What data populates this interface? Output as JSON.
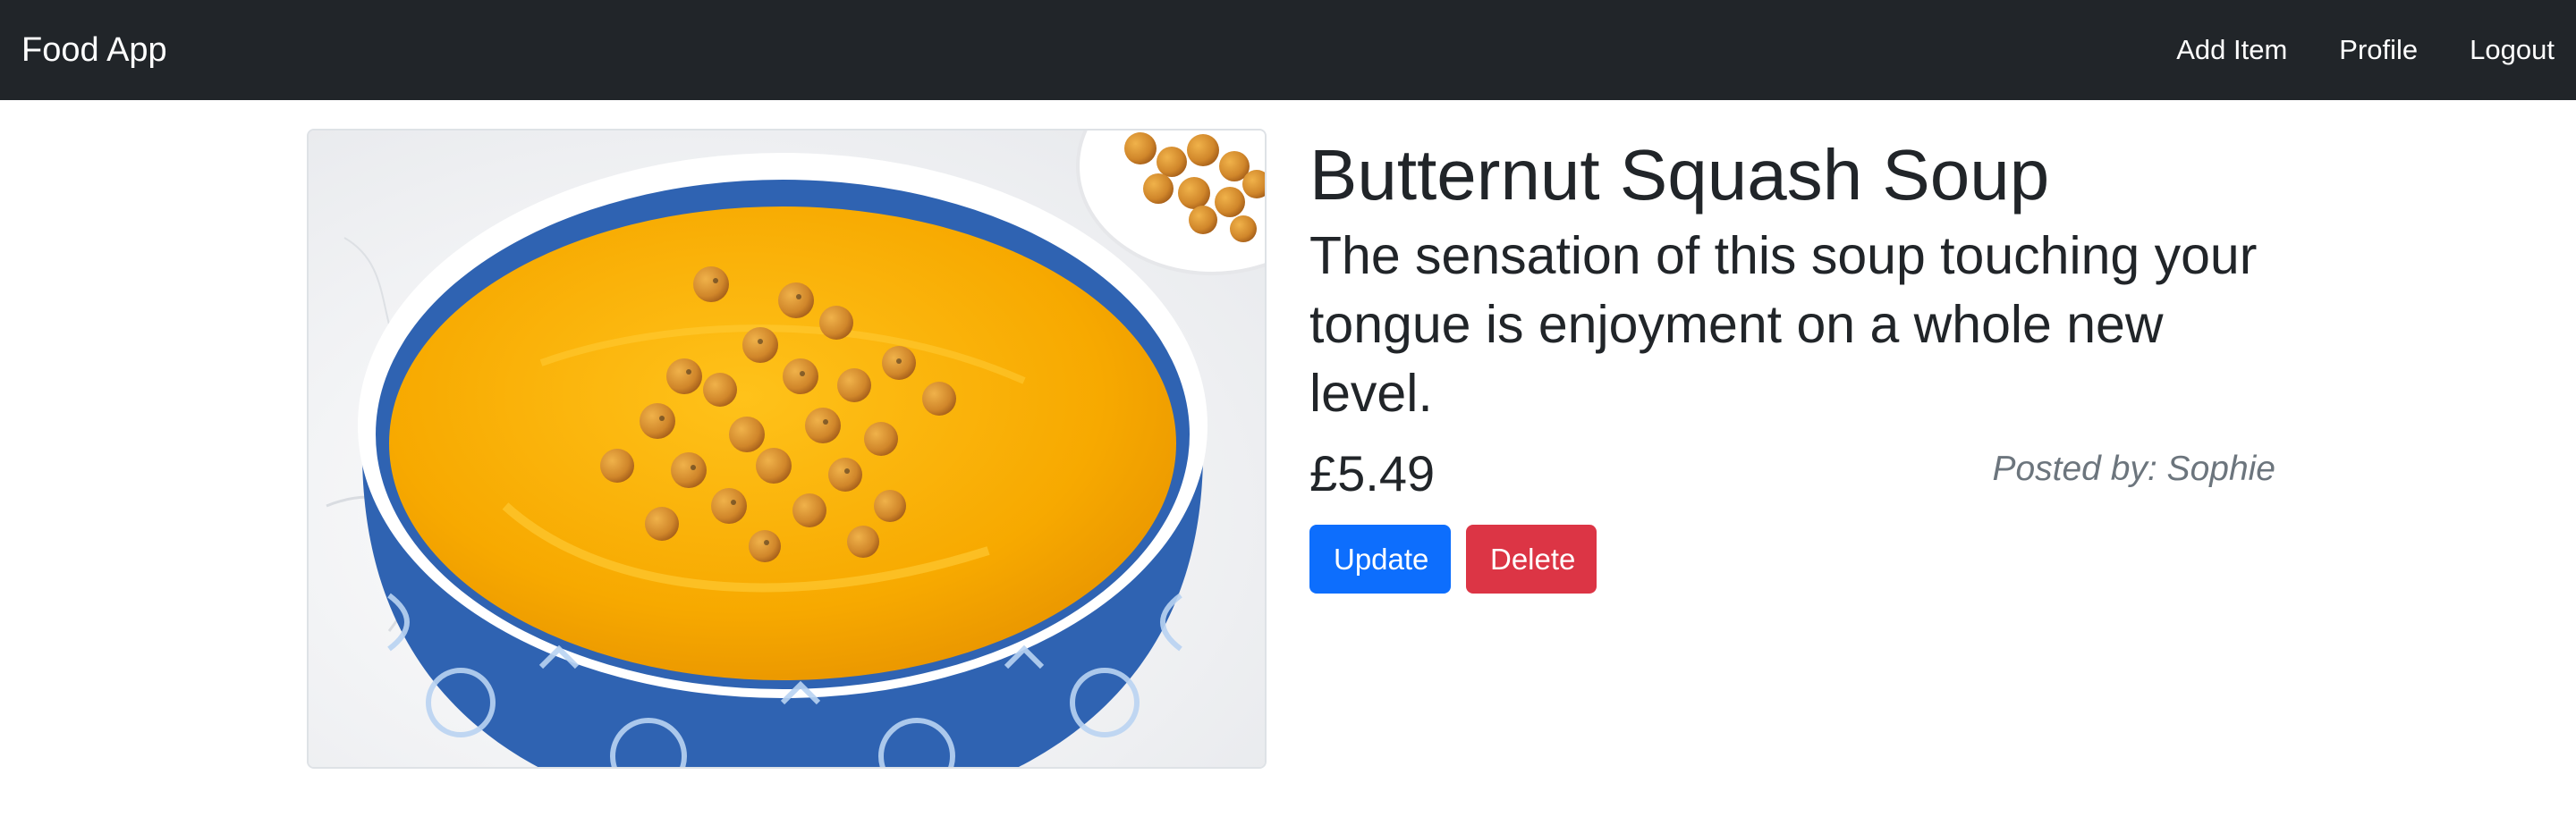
{
  "navbar": {
    "brand": "Food App",
    "links": [
      "Add Item",
      "Profile",
      "Logout"
    ]
  },
  "item": {
    "title": "Butternut Squash Soup",
    "description": "The sensation of this soup touching your tongue is enjoyment on a whole new level.",
    "price": "£5.49",
    "posted_by": "Posted by: Sophie",
    "image_subject": "bowl of butternut squash soup topped with roasted chickpeas"
  },
  "actions": {
    "update_label": "Update",
    "delete_label": "Delete"
  },
  "colors": {
    "navbar_bg": "#212529",
    "primary": "#0d6efd",
    "danger": "#dc3545",
    "muted": "#6c757d",
    "soup": "#f5a400",
    "bowl": "#2f63b2"
  }
}
